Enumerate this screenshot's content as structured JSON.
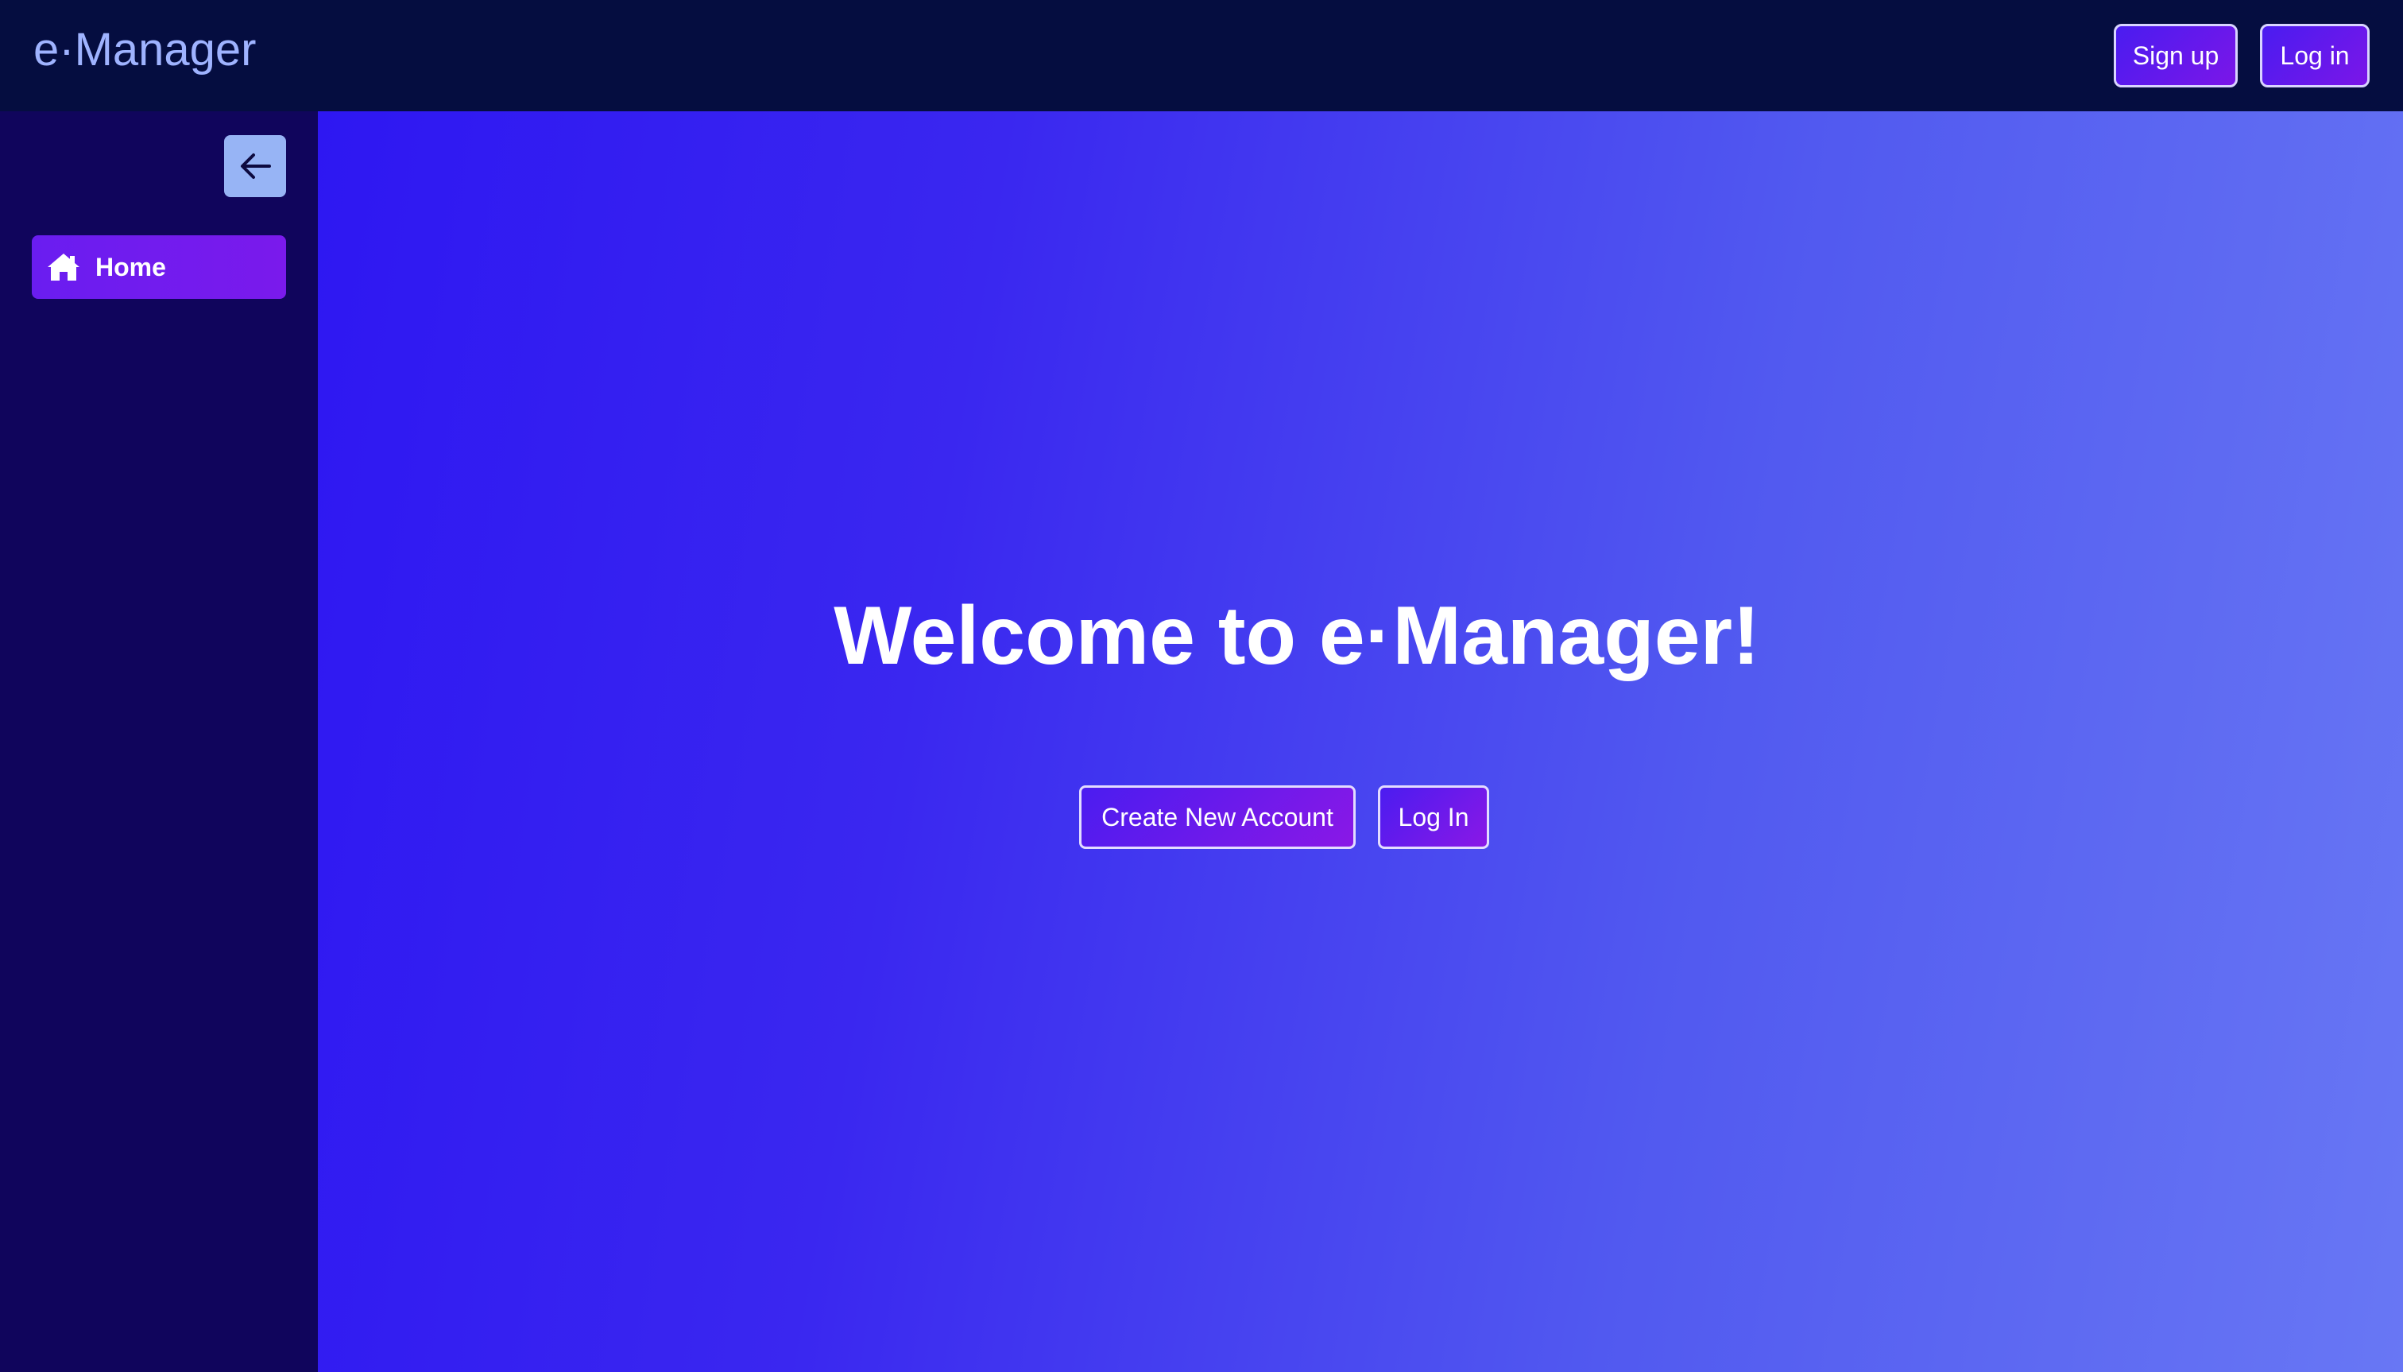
{
  "header": {
    "brand": "e·Manager",
    "signup_label": "Sign up",
    "login_label": "Log in"
  },
  "sidebar": {
    "collapse_icon": "arrow-left-icon",
    "items": [
      {
        "label": "Home",
        "icon": "home-icon",
        "active": true
      }
    ]
  },
  "main": {
    "welcome_title": "Welcome to e·Manager!",
    "create_account_label": "Create New Account",
    "login_label": "Log In"
  },
  "colors": {
    "header_bg": "#050d40",
    "sidebar_bg": "#10055c",
    "accent_purple": "#6a1df0",
    "main_gradient_start": "#2e17f2",
    "main_gradient_end": "#6877f4",
    "brand_text": "#9fb3ff",
    "collapse_button_bg": "#97b4f5"
  }
}
